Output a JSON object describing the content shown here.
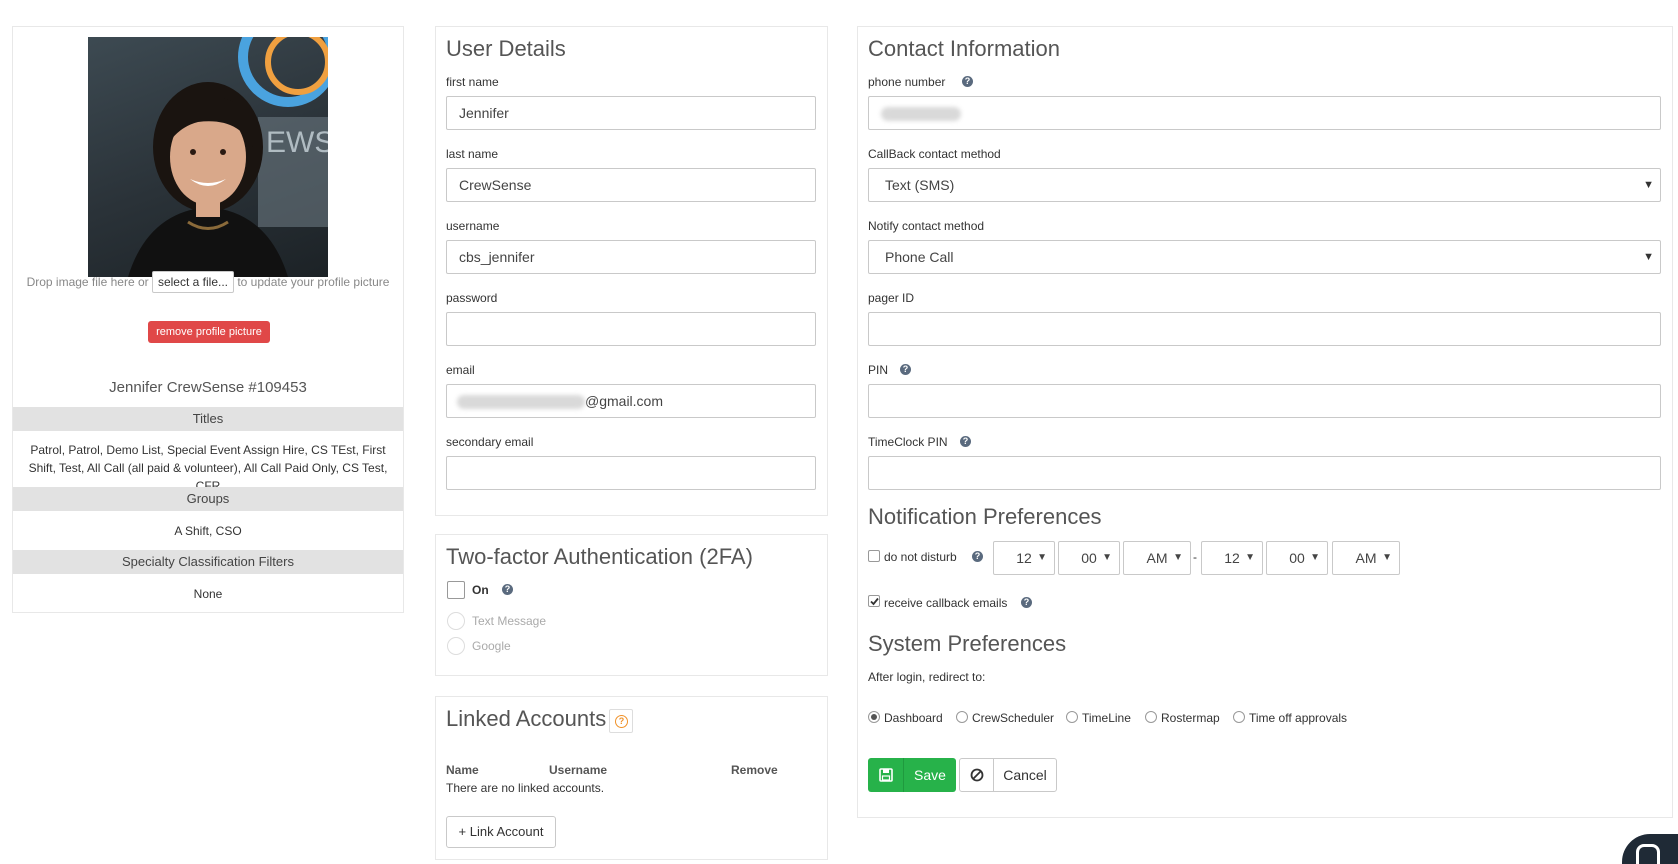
{
  "profile": {
    "drop_text_before": "Drop image file here or",
    "select_file_label": "select a file...",
    "drop_text_after": "to update your profile picture",
    "remove_picture_label": "remove profile picture",
    "display_name": "Jennifer CrewSense #109453",
    "titles_header": "Titles",
    "titles_value": "Patrol, Patrol, Demo List, Special Event Assign Hire, CS TEst, First Shift, Test, All Call (all paid & volunteer), All Call Paid Only, CS Test, CFR",
    "groups_header": "Groups",
    "groups_value": "A Shift, CSO",
    "specialty_header": "Specialty Classification Filters",
    "specialty_value": "None"
  },
  "user_details": {
    "heading": "User Details",
    "first_name_label": "first name",
    "first_name_value": "Jennifer",
    "last_name_label": "last name",
    "last_name_value": "CrewSense",
    "username_label": "username",
    "username_value": "cbs_jennifer",
    "password_label": "password",
    "password_value": "",
    "email_label": "email",
    "email_suffix": "@gmail.com",
    "secondary_email_label": "secondary email",
    "secondary_email_value": ""
  },
  "two_factor": {
    "heading": "Two-factor Authentication (2FA)",
    "on_label": "On",
    "option_text_message": "Text Message",
    "option_google": "Google"
  },
  "linked_accounts": {
    "heading": "Linked Accounts",
    "columns": [
      "Name",
      "Username",
      "Remove"
    ],
    "empty_text": "There are no linked accounts.",
    "link_button_label": "+ Link Account"
  },
  "contact": {
    "heading": "Contact Information",
    "phone_label": "phone number",
    "callback_label": "CallBack contact method",
    "callback_value": "Text (SMS)",
    "notify_label": "Notify contact method",
    "notify_value": "Phone Call",
    "pager_label": "pager ID",
    "pin_label": "PIN",
    "timeclock_pin_label": "TimeClock PIN"
  },
  "notifications": {
    "heading": "Notification Preferences",
    "dnd_label": "do not disturb",
    "dnd_from_hour": "12",
    "dnd_from_min": "00",
    "dnd_from_ampm": "AM",
    "dash": "-",
    "dnd_to_hour": "12",
    "dnd_to_min": "00",
    "dnd_to_ampm": "AM",
    "callback_emails_label": "receive callback emails"
  },
  "system": {
    "heading": "System Preferences",
    "redirect_label": "After login, redirect to:",
    "options": [
      "Dashboard",
      "CrewScheduler",
      "TimeLine",
      "Rostermap",
      "Time off approvals"
    ],
    "selected": "Dashboard"
  },
  "actions": {
    "save_label": "Save",
    "cancel_label": "Cancel"
  },
  "colors": {
    "save_green": "#27b24a",
    "remove_red": "#e04848",
    "help_icon": "#5a6a7e",
    "orange_help": "#f0922a"
  }
}
